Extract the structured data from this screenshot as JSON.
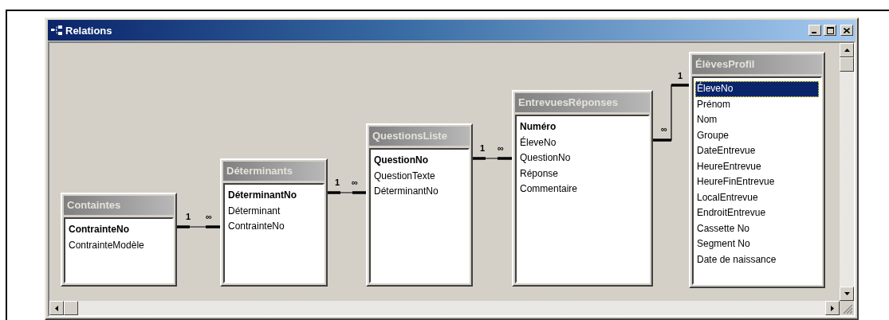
{
  "window": {
    "title": "Relations"
  },
  "tables": [
    {
      "title": "Containtes",
      "fields": [
        {
          "name": "ContrainteNo",
          "key": true,
          "selected": false
        },
        {
          "name": "ContrainteModèle",
          "key": false,
          "selected": false
        }
      ]
    },
    {
      "title": "Déterminants",
      "fields": [
        {
          "name": "DéterminantNo",
          "key": true,
          "selected": false
        },
        {
          "name": "Déterminant",
          "key": false,
          "selected": false
        },
        {
          "name": "ContrainteNo",
          "key": false,
          "selected": false
        }
      ]
    },
    {
      "title": "QuestionsListe",
      "fields": [
        {
          "name": "QuestionNo",
          "key": true,
          "selected": false
        },
        {
          "name": "QuestionTexte",
          "key": false,
          "selected": false
        },
        {
          "name": "DéterminantNo",
          "key": false,
          "selected": false
        }
      ]
    },
    {
      "title": "EntrevuesRéponses",
      "fields": [
        {
          "name": "Numéro",
          "key": true,
          "selected": false
        },
        {
          "name": "ÉleveNo",
          "key": false,
          "selected": false
        },
        {
          "name": "QuestionNo",
          "key": false,
          "selected": false
        },
        {
          "name": "Réponse",
          "key": false,
          "selected": false
        },
        {
          "name": "Commentaire",
          "key": false,
          "selected": false
        }
      ]
    },
    {
      "title": "ÉlèvesProfil",
      "fields": [
        {
          "name": "ÉleveNo",
          "key": false,
          "selected": true
        },
        {
          "name": "Prénom",
          "key": false,
          "selected": false
        },
        {
          "name": "Nom",
          "key": false,
          "selected": false
        },
        {
          "name": "Groupe",
          "key": false,
          "selected": false
        },
        {
          "name": "DateEntrevue",
          "key": false,
          "selected": false
        },
        {
          "name": "HeureEntrevue",
          "key": false,
          "selected": false
        },
        {
          "name": "HeureFinEntrevue",
          "key": false,
          "selected": false
        },
        {
          "name": "LocalEntrevue",
          "key": false,
          "selected": false
        },
        {
          "name": "EndroitEntrevue",
          "key": false,
          "selected": false
        },
        {
          "name": "Cassette No",
          "key": false,
          "selected": false
        },
        {
          "name": "Segment No",
          "key": false,
          "selected": false
        },
        {
          "name": "Date de naissance",
          "key": false,
          "selected": false
        }
      ]
    }
  ],
  "relationships": [
    {
      "one": "1",
      "many": "∞"
    },
    {
      "one": "1",
      "many": "∞"
    },
    {
      "one": "1",
      "many": "∞"
    },
    {
      "one": "1",
      "many": "∞"
    }
  ]
}
